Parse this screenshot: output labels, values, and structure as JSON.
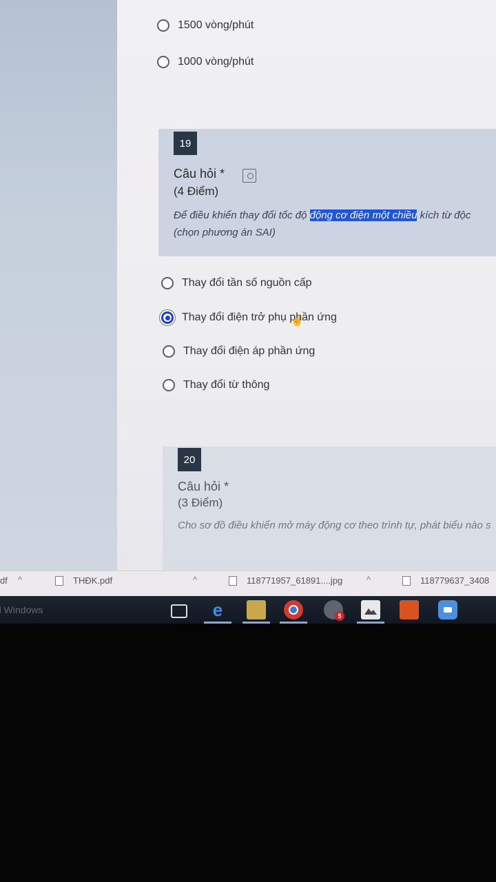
{
  "prev_question": {
    "options": [
      "1500 vòng/phút",
      "1000 vòng/phút"
    ]
  },
  "q19": {
    "number": "19",
    "title": "Câu hỏi *",
    "points": "(4 Điểm)",
    "text_before": "Để điều khiển thay đổi tốc độ ",
    "text_highlight": "động cơ điện một chiều",
    "text_after": " kích từ độc",
    "text_line2": "(chọn phương án SAI)",
    "options": [
      "Thay đổi tần số nguồn cấp",
      "Thay đổi điện trở phụ phần ứng",
      "Thay đổi điện áp phần ứng",
      "Thay đổi từ thông"
    ],
    "selected_index": 1
  },
  "q20": {
    "number": "20",
    "title": "Câu hỏi *",
    "points": "(3 Điểm)",
    "text": "Cho sơ đồ điều khiển mở máy động cơ theo trình tự, phát biểu nào s"
  },
  "downloads_bar": {
    "left_fragment": "df",
    "items": [
      "THĐK.pdf",
      "118771957_61891....jpg",
      "118779637_3408"
    ]
  },
  "taskbar": {
    "left_label": "d Windows",
    "icons": [
      "task-view-icon",
      "edge-icon",
      "file-explorer-icon",
      "chrome-icon",
      "notification-app-icon",
      "photos-icon",
      "office-icon",
      "zoom-icon"
    ],
    "badge": "5"
  },
  "colors": {
    "accent": "#1f55d6",
    "question_header": "#ccd4e1",
    "number_badge": "#283646",
    "taskbar": "#161d27"
  }
}
